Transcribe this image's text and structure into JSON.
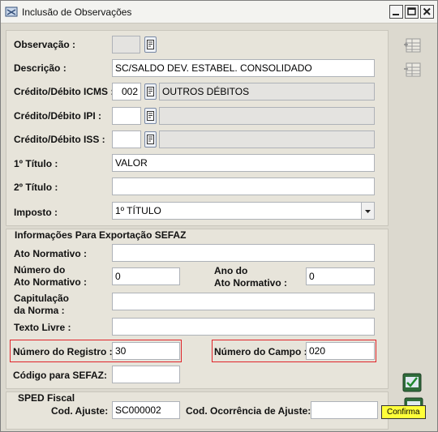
{
  "window": {
    "title": "Inclusão de Observações"
  },
  "fields": {
    "observacao": {
      "label": "Observação :",
      "value": ""
    },
    "descricao": {
      "label": "Descrição :",
      "value": "SC/SALDO DEV. ESTABEL. CONSOLIDADO"
    },
    "credito_icms": {
      "label": "Crédito/Débito ICMS :",
      "code": "002",
      "description": "OUTROS DÉBITOS"
    },
    "credito_ipi": {
      "label": "Crédito/Débito IPI :",
      "code": "",
      "description": ""
    },
    "credito_iss": {
      "label": "Crédito/Débito ISS :",
      "code": "",
      "description": ""
    },
    "titulo1": {
      "label": "1º Título :",
      "value": "VALOR"
    },
    "titulo2": {
      "label": "2º Título :",
      "value": ""
    },
    "imposto": {
      "label": "Imposto :",
      "value": "1º TÍTULO"
    }
  },
  "sefaz": {
    "section_title": "Informações Para Exportação SEFAZ",
    "ato_normativo": {
      "label": "Ato Normativo :",
      "value": ""
    },
    "numero_ato": {
      "label_line1": "Número do",
      "label_line2": "Ato Normativo :",
      "value": "0"
    },
    "ano_ato": {
      "label_line1": "Ano do",
      "label_line2": "Ato Normativo :",
      "value": "0"
    },
    "capitulacao": {
      "label_line1": "Capitulação",
      "label_line2": "da Norma :",
      "value": ""
    },
    "texto_livre": {
      "label": "Texto Livre :",
      "value": ""
    },
    "numero_registro": {
      "label": "Número do Registro :",
      "value": "30"
    },
    "numero_campo": {
      "label": "Número do Campo :",
      "value": "020"
    },
    "codigo_sefaz": {
      "label": "Código para SEFAZ:",
      "value": ""
    }
  },
  "sped": {
    "section_title": "SPED Fiscal",
    "cod_ajuste": {
      "label": "Cod. Ajuste:",
      "value": "SC000002"
    },
    "cod_ocorrencia": {
      "label": "Cod. Ocorrência de Ajuste:",
      "value": ""
    }
  },
  "tooltip": "Confirma",
  "icons": {
    "window": "app-icon",
    "lookup": "lookup-icon",
    "side1": "insert-row-icon",
    "side2": "delete-row-icon",
    "confirm": "confirm-icon",
    "cancel": "cancel-icon"
  },
  "colors": {
    "highlight_border": "#e0242a",
    "tooltip_bg": "#ffff3a"
  }
}
